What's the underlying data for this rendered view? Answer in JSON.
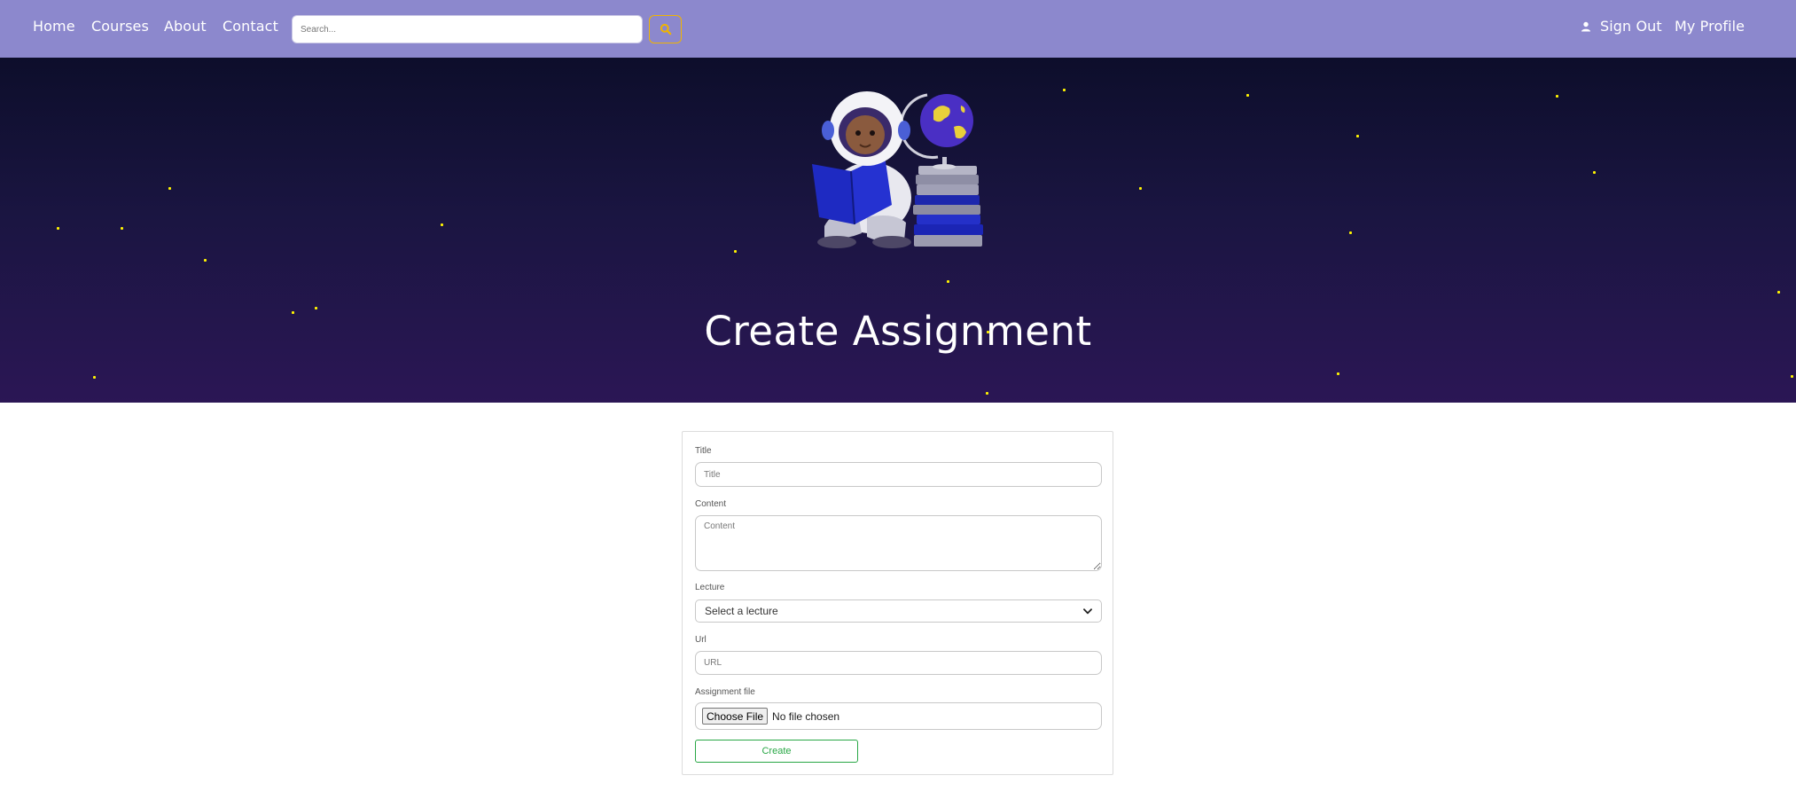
{
  "nav": {
    "links": [
      "Home",
      "Courses",
      "About",
      "Contact"
    ],
    "search_placeholder": "Search...",
    "sign_out": "Sign Out",
    "my_profile": "My Profile"
  },
  "hero": {
    "title": "Create Assignment"
  },
  "form": {
    "title_label": "Title",
    "title_placeholder": "Title",
    "content_label": "Content",
    "content_placeholder": "Content",
    "lecture_label": "Lecture",
    "lecture_selected": "Select a lecture",
    "url_label": "Url",
    "url_placeholder": "URL",
    "file_label": "Assignment file",
    "choose_file": "Choose File",
    "file_status": "No file chosen",
    "create_button": "Create"
  },
  "colors": {
    "nav_bg": "#8c88cd",
    "search_button_border": "#f0b400",
    "hero_top": "#0d0e2b",
    "hero_bottom": "#2b1655",
    "star": "#fff400",
    "create_button": "#28a745"
  },
  "icons": {
    "search": "magnifier-icon",
    "sign_out": "user-icon",
    "select": "chevron-down-icon"
  }
}
